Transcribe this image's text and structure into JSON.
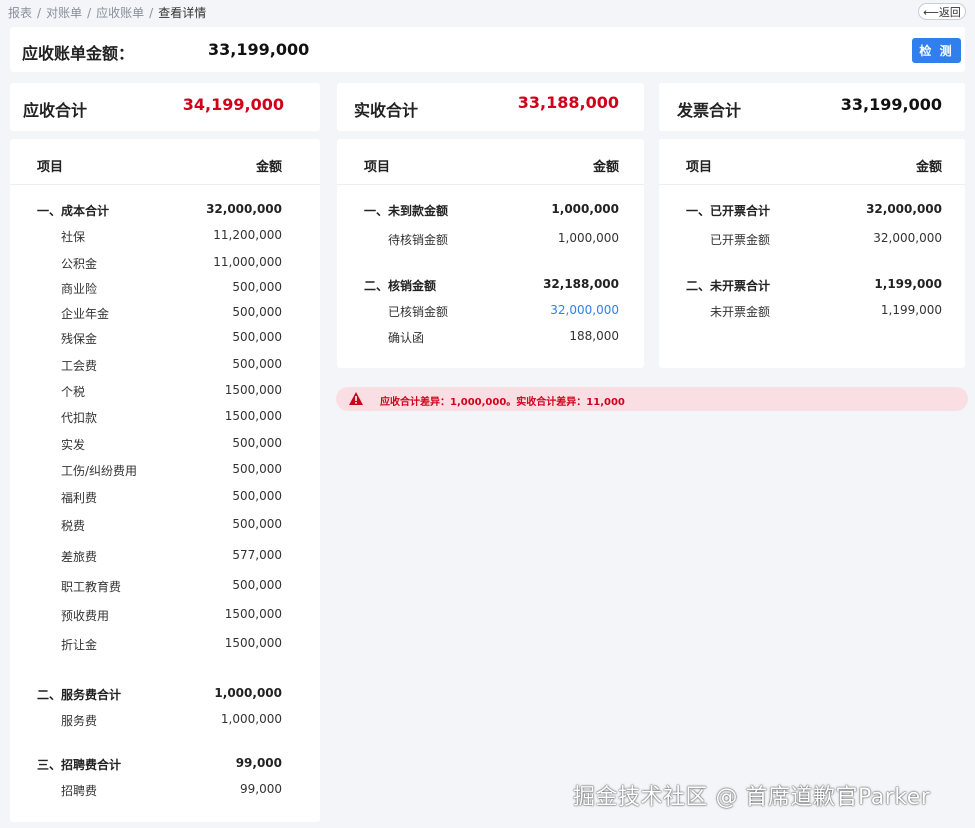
{
  "breadcrumb": {
    "items": [
      "报表",
      "对账单",
      "应收账单"
    ],
    "current": "查看详情"
  },
  "back_label": "⟵返回",
  "summary": {
    "label": "应收账单金额：",
    "value": "33,199,000",
    "check_label": "检 测"
  },
  "receivable": {
    "title": "应收合计",
    "total": "34,199,000",
    "col_item": "项目",
    "col_amount": "金额",
    "rows": [
      {
        "type": "grp",
        "label": "一、成本合计",
        "value": "32,000,000"
      },
      {
        "type": "sub",
        "label": "社保",
        "value": "11,200,000"
      },
      {
        "type": "sub",
        "label": "公积金",
        "value": "11,000,000"
      },
      {
        "type": "sub",
        "label": "商业险",
        "value": "500,000"
      },
      {
        "type": "sub",
        "label": "企业年金",
        "value": "500,000"
      },
      {
        "type": "sub",
        "label": "残保金",
        "value": "500,000"
      },
      {
        "type": "sub",
        "label": "工会费",
        "value": "500,000"
      },
      {
        "type": "sub",
        "label": "个税",
        "value": "1500,000"
      },
      {
        "type": "sub",
        "label": "代扣款",
        "value": "1500,000"
      },
      {
        "type": "sub",
        "label": "实发",
        "value": "500,000"
      },
      {
        "type": "sub",
        "label": "工伤/纠纷费用",
        "value": "500,000"
      },
      {
        "type": "sub",
        "label": "福利费",
        "value": "500,000"
      },
      {
        "type": "sub",
        "label": "税费",
        "value": "500,000"
      },
      {
        "type": "sub",
        "label": "差旅费",
        "value": "577,000"
      },
      {
        "type": "sub",
        "label": "职工教育费",
        "value": "500,000"
      },
      {
        "type": "sub",
        "label": "预收费用",
        "value": "1500,000"
      },
      {
        "type": "sub",
        "label": " 折让金",
        "value": "1500,000"
      },
      {
        "type": "grp",
        "label": "二、服务费合计",
        "value": "1,000,000"
      },
      {
        "type": "sub",
        "label": "服务费",
        "value": "1,000,000"
      },
      {
        "type": "grp",
        "label": "三、招聘费合计",
        "value": "99,000"
      },
      {
        "type": "sub",
        "label": "招聘费",
        "value": "99,000"
      }
    ]
  },
  "received": {
    "title": "实收合计",
    "total": "33,188,000",
    "col_item": "项目",
    "col_amount": "金额",
    "rows": [
      {
        "type": "grp",
        "label": "一、未到款金额",
        "value": "1,000,000"
      },
      {
        "type": "sub",
        "label": "待核销金额",
        "value": "1,000,000"
      },
      {
        "type": "grp",
        "label": "二、核销金额",
        "value": "32,188,000"
      },
      {
        "type": "sub",
        "label": "已核销金额",
        "value": "32,000,000",
        "link": true
      },
      {
        "type": "sub",
        "label": "确认函",
        "value": "188,000"
      }
    ]
  },
  "invoice": {
    "title": "发票合计",
    "total": "33,199,000",
    "col_item": "项目",
    "col_amount": "金额",
    "rows": [
      {
        "type": "grp",
        "label": "一、已开票合计",
        "value": "32,000,000"
      },
      {
        "type": "sub",
        "label": "已开票金额",
        "value": "32,000,000"
      },
      {
        "type": "grp",
        "label": "二、未开票合计",
        "value": "1,199,000"
      },
      {
        "type": "sub",
        "label": "未开票金额",
        "value": "1,199,000"
      }
    ]
  },
  "alert": {
    "text": "应收合计差异：1,000,000。实收合计差异：11,000",
    "color": "#d0021b",
    "icon": "warning-icon"
  },
  "watermark": "掘金技术社区 @ 首席道歉官Parker",
  "colors": {
    "accent": "#2f80ed",
    "danger": "#d0021b",
    "background": "#f3f5f8"
  }
}
